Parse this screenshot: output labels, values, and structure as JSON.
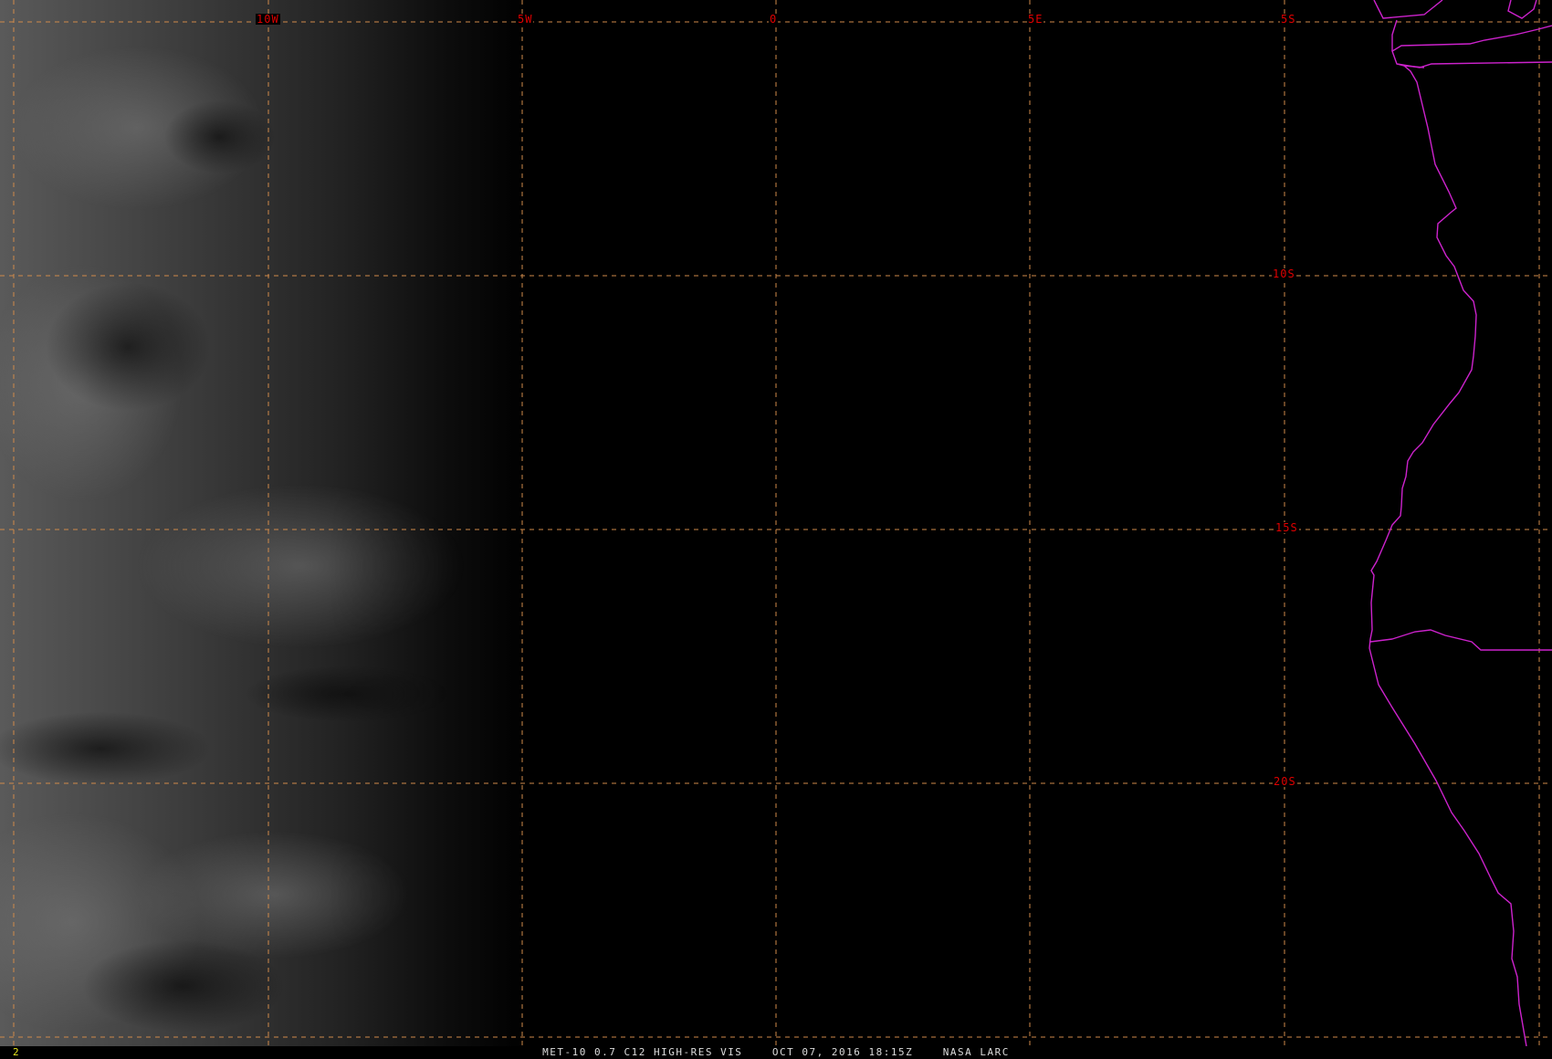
{
  "map": {
    "longitude_labels": [
      "10W",
      "5W",
      "0",
      "5E"
    ],
    "latitude_labels": [
      "5S",
      "10S",
      "15S",
      "20S"
    ],
    "colors": {
      "background": "#000000",
      "graticule": "#d08a4a",
      "grid_labels": "#e00000",
      "coastline": "#cc22cc",
      "frame_number": "#e6e61e",
      "caption": "#dcdcdc"
    }
  },
  "status_bar": {
    "frame_number": "2",
    "caption": "MET-10 0.7 C12 HIGH-RES VIS    OCT 07, 2016 18:15Z    NASA LARC"
  }
}
